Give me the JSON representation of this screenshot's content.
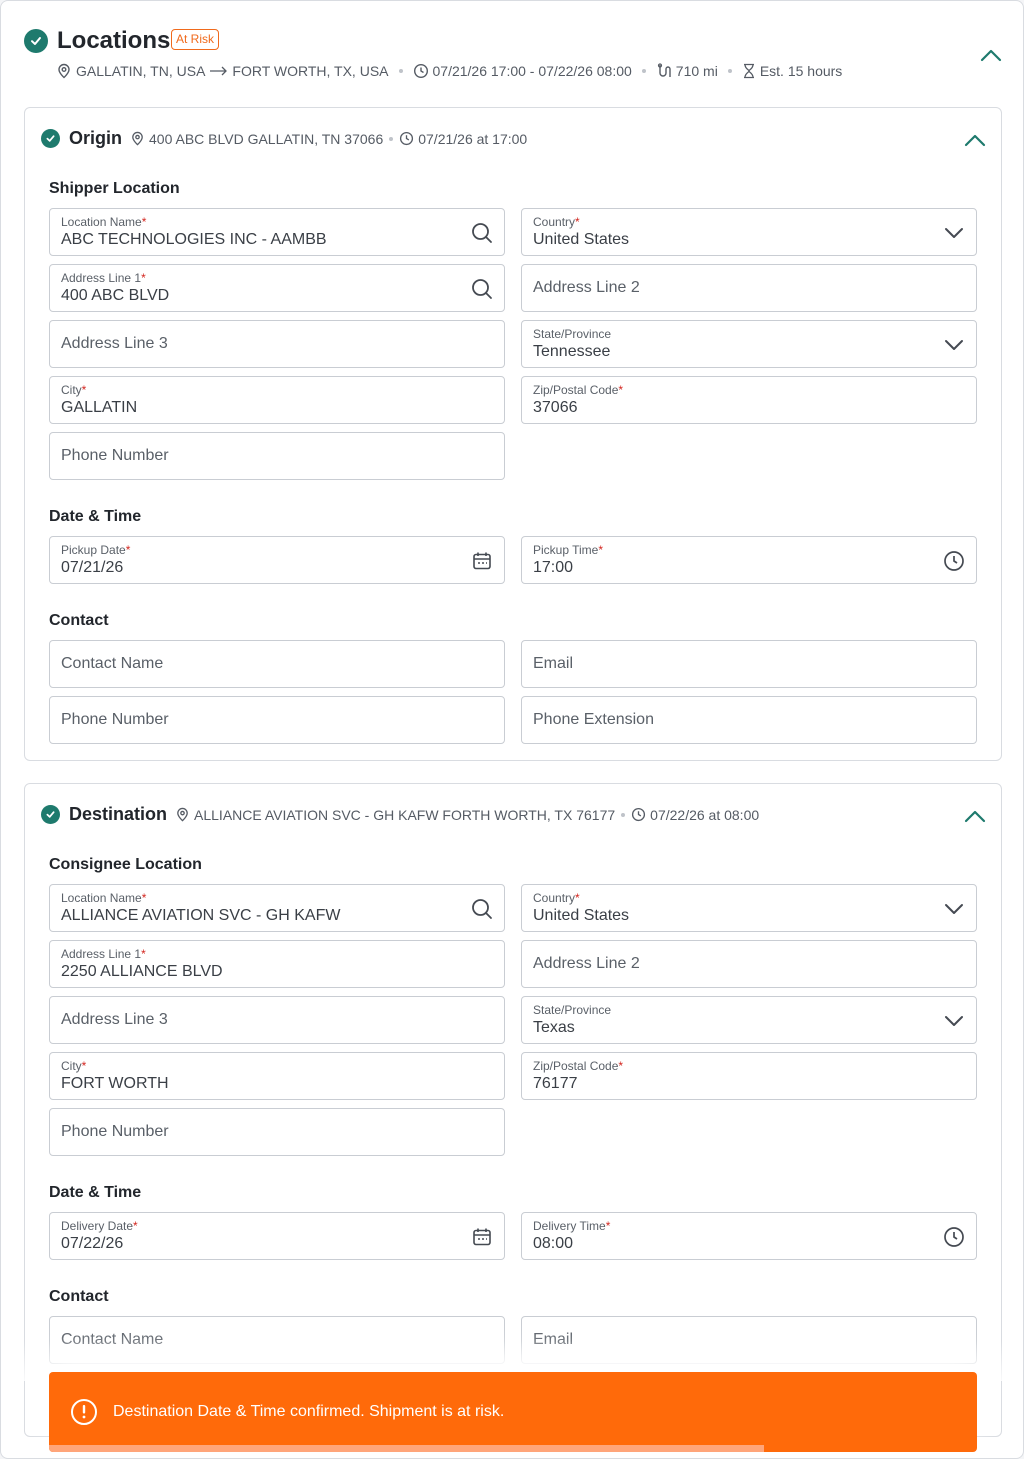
{
  "header": {
    "title": "Locations",
    "risk_badge": "At Risk",
    "route_origin": "GALLATIN, TN, USA",
    "route_destination": "FORT WORTH, TX, USA",
    "window": "07/21/26 17:00 - 07/22/26 08:00",
    "distance": "710 mi",
    "duration": "Est. 15 hours"
  },
  "origin": {
    "title": "Origin",
    "address_summary": "400 ABC BLVD GALLATIN, TN 37066",
    "time_summary": "07/21/26 at 17:00",
    "location_heading": "Shipper Location",
    "location_name": {
      "label": "Location Name",
      "value": "ABC TECHNOLOGIES INC - AAMBB"
    },
    "country": {
      "label": "Country",
      "value": "United States"
    },
    "address1": {
      "label": "Address Line 1",
      "value": "400 ABC BLVD"
    },
    "address2": {
      "placeholder": "Address Line 2"
    },
    "address3": {
      "placeholder": "Address Line 3"
    },
    "state": {
      "label": "State/Province",
      "value": "Tennessee"
    },
    "city": {
      "label": "City",
      "value": "GALLATIN"
    },
    "zip": {
      "label": "Zip/Postal Code",
      "value": "37066"
    },
    "phone": {
      "placeholder": "Phone Number"
    },
    "datetime_heading": "Date & Time",
    "date": {
      "label": "Pickup Date",
      "value": "07/21/26"
    },
    "time": {
      "label": "Pickup Time",
      "value": "17:00"
    },
    "contact_heading": "Contact",
    "contact_name": {
      "placeholder": "Contact Name"
    },
    "email": {
      "placeholder": "Email"
    },
    "contact_phone": {
      "placeholder": "Phone Number"
    },
    "phone_ext": {
      "placeholder": "Phone Extension"
    }
  },
  "destination": {
    "title": "Destination",
    "address_summary": "ALLIANCE AVIATION SVC - GH KAFW FORTH WORTH, TX 76177",
    "time_summary": "07/22/26 at 08:00",
    "location_heading": "Consignee Location",
    "location_name": {
      "label": "Location Name",
      "value": "ALLIANCE AVIATION SVC - GH KAFW"
    },
    "country": {
      "label": "Country",
      "value": "United States"
    },
    "address1": {
      "label": "Address Line 1",
      "value": "2250 ALLIANCE BLVD"
    },
    "address2": {
      "placeholder": "Address Line 2"
    },
    "address3": {
      "placeholder": "Address Line 3"
    },
    "state": {
      "label": "State/Province",
      "value": "Texas"
    },
    "city": {
      "label": "City",
      "value": "FORT WORTH"
    },
    "zip": {
      "label": "Zip/Postal Code",
      "value": "76177"
    },
    "phone": {
      "placeholder": "Phone Number"
    },
    "datetime_heading": "Date & Time",
    "date": {
      "label": "Delivery Date",
      "value": "07/22/26"
    },
    "time": {
      "label": "Delivery Time",
      "value": "08:00"
    },
    "contact_heading": "Contact",
    "contact_name": {
      "placeholder": "Contact Name"
    },
    "email": {
      "placeholder": "Email"
    }
  },
  "toast": {
    "message": "Destination Date & Time confirmed. Shipment is at risk.",
    "progress": 0.77
  },
  "colors": {
    "accent_teal": "#1e7a6d",
    "risk_orange": "#f06a1c",
    "toast_bg": "#ff6a0a",
    "required_red": "#d3261f"
  }
}
